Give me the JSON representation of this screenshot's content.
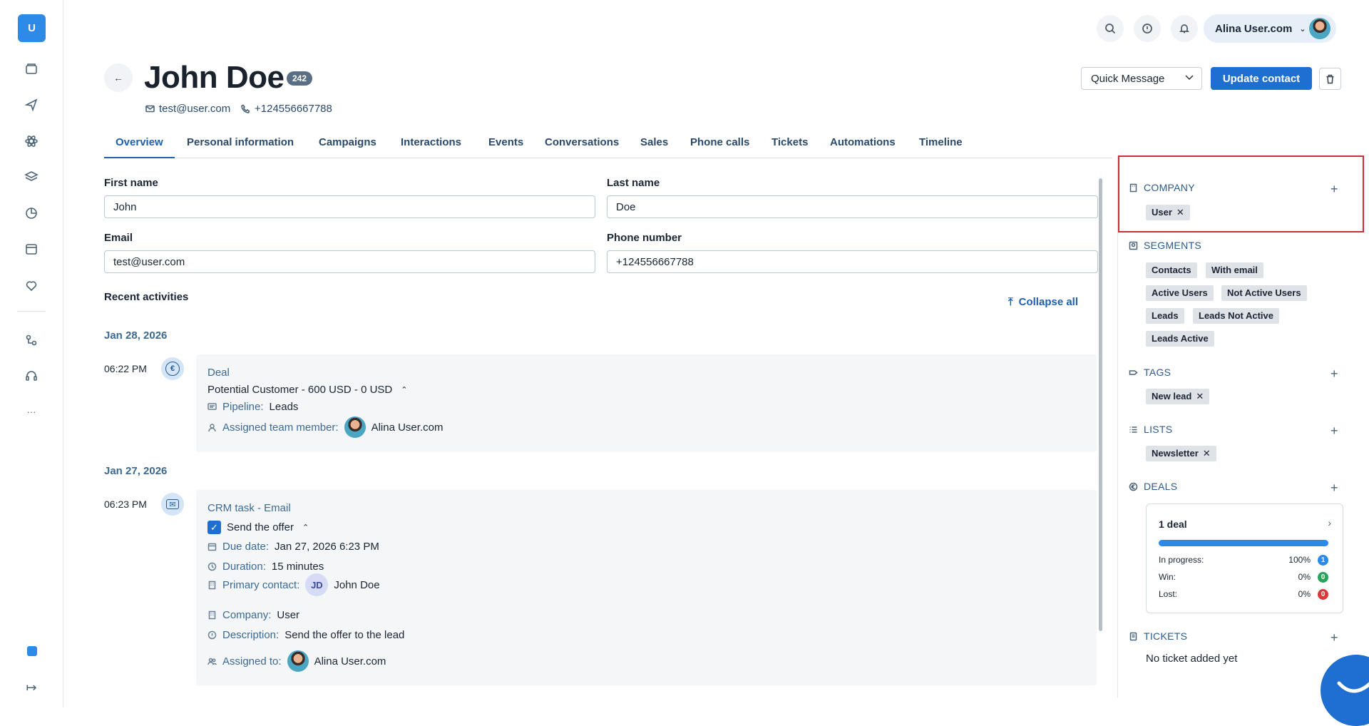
{
  "app": {
    "logo_letter": "U",
    "accent": "#1e6fd1"
  },
  "rail": {
    "icons": [
      "inbox-icon",
      "send-icon",
      "atom-icon",
      "layers-icon",
      "pie-chart-icon",
      "calendar-window-icon",
      "tag-heart-icon",
      "flow-icon",
      "headset-icon",
      "more-icon"
    ],
    "more_label": "···"
  },
  "topbar": {
    "user_name": "Alina User.com"
  },
  "header": {
    "title": "John Doe",
    "count_badge": "242",
    "email": "test@user.com",
    "phone": "+124556667788",
    "quick_message": "Quick Message",
    "update_button": "Update contact"
  },
  "tabs": [
    "Overview",
    "Personal information",
    "Campaigns",
    "Interactions",
    "Events",
    "Conversations",
    "Sales",
    "Phone calls",
    "Tickets",
    "Automations",
    "Timeline"
  ],
  "form": {
    "first_name_label": "First name",
    "first_name": "John",
    "last_name_label": "Last name",
    "last_name": "Doe",
    "email_label": "Email",
    "email": "test@user.com",
    "phone_label": "Phone number",
    "phone": "+124556667788"
  },
  "activities": {
    "title": "Recent activities",
    "collapse_all": "Collapse all",
    "groups": [
      {
        "date": "Jan 28, 2026",
        "time": "06:22 PM",
        "icon": "euro-icon",
        "card": {
          "type": "Deal",
          "summary": "Potential Customer - 600 USD - 0 USD",
          "pipeline_label": "Pipeline:",
          "pipeline": "Leads",
          "assigned_label": "Assigned team member:",
          "assigned": "Alina User.com"
        }
      },
      {
        "date": "Jan 27, 2026",
        "time": "06:23 PM",
        "icon": "mail-icon",
        "card": {
          "type": "CRM task - Email",
          "task": "Send the offer",
          "due_label": "Due date:",
          "due": "Jan 27, 2026 6:23 PM",
          "duration_label": "Duration:",
          "duration": "15 minutes",
          "primary_label": "Primary contact:",
          "primary_initials": "JD",
          "primary": "John Doe",
          "company_label": "Company:",
          "company": "User",
          "description_label": "Description:",
          "description": "Send the offer to the lead",
          "assigned_label": "Assigned to:",
          "assigned": "Alina User.com"
        }
      }
    ]
  },
  "sidebar": {
    "company": {
      "title": "COMPANY",
      "chips": [
        "User"
      ]
    },
    "segments": {
      "title": "SEGMENTS",
      "chips": [
        "Contacts",
        "With email",
        "Active Users",
        "Not Active Users",
        "Leads",
        "Leads Not Active",
        "Leads Active"
      ]
    },
    "tags": {
      "title": "TAGS",
      "chips": [
        "New lead"
      ]
    },
    "lists": {
      "title": "LISTS",
      "chips": [
        "Newsletter"
      ]
    },
    "deals": {
      "title": "DEALS",
      "card_title": "1 deal",
      "stats": [
        {
          "label": "In progress:",
          "pct": "100%",
          "count": "1",
          "color": "#2a8ae8"
        },
        {
          "label": "Win:",
          "pct": "0%",
          "count": "0",
          "color": "#27a35a"
        },
        {
          "label": "Lost:",
          "pct": "0%",
          "count": "0",
          "color": "#d93a3a"
        }
      ],
      "progress_fraction": 1.0
    },
    "tickets": {
      "title": "TICKETS",
      "empty": "No ticket added yet"
    }
  }
}
